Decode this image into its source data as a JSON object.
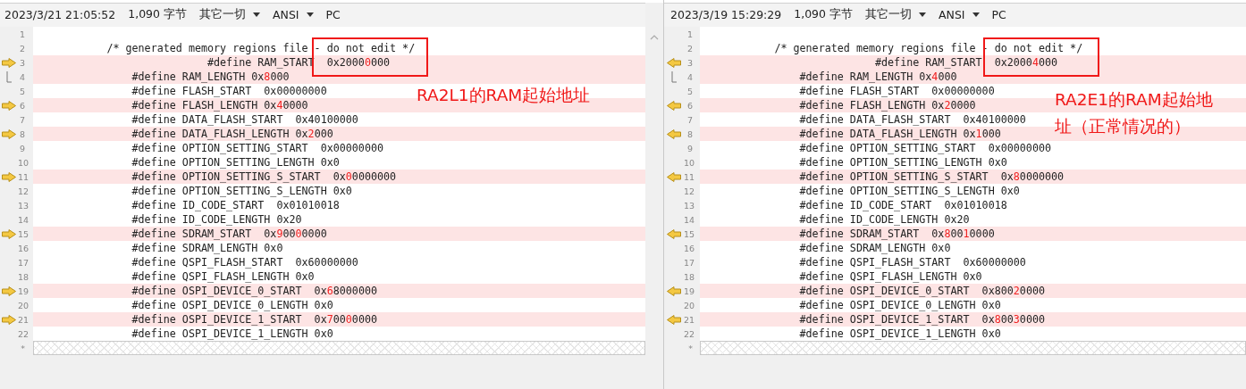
{
  "panes": [
    {
      "kind": "left",
      "header": {
        "timestamp": "2023/3/21 21:05:52",
        "size": "1,090 字节",
        "filter": "其它一切",
        "encoding": "ANSI",
        "line_ending": "PC"
      },
      "lines": [
        {
          "number": "1",
          "changed": false,
          "kind": "plain"
        },
        {
          "number": "2",
          "changed": false,
          "kind": "plain",
          "text": "           /* generated memory regions file - do not edit */"
        },
        {
          "number": "3",
          "changed": true,
          "kind": "arrow",
          "segments": [
            {
              "text": "                           #define RAM_START  0x2000",
              "diff": false
            },
            {
              "text": "0",
              "diff": true
            },
            {
              "text": "000",
              "diff": false
            }
          ]
        },
        {
          "number": "4",
          "changed": true,
          "kind": "bracket",
          "segments": [
            {
              "text": "               #define RAM_LENGTH 0x",
              "diff": false
            },
            {
              "text": "8",
              "diff": true
            },
            {
              "text": "000",
              "diff": false
            }
          ]
        },
        {
          "number": "5",
          "changed": false,
          "kind": "plain",
          "text": "               #define FLASH_START  0x00000000"
        },
        {
          "number": "6",
          "changed": true,
          "kind": "arrow",
          "segments": [
            {
              "text": "               #define FLASH_LENGTH 0x",
              "diff": false
            },
            {
              "text": "4",
              "diff": true
            },
            {
              "text": "0000",
              "diff": false
            }
          ]
        },
        {
          "number": "7",
          "changed": false,
          "kind": "plain",
          "text": "               #define DATA_FLASH_START  0x40100000"
        },
        {
          "number": "8",
          "changed": true,
          "kind": "arrow",
          "segments": [
            {
              "text": "               #define DATA_FLASH_LENGTH 0x",
              "diff": false
            },
            {
              "text": "2",
              "diff": true
            },
            {
              "text": "000",
              "diff": false
            }
          ]
        },
        {
          "number": "9",
          "changed": false,
          "kind": "plain",
          "text": "               #define OPTION_SETTING_START  0x00000000"
        },
        {
          "number": "10",
          "changed": false,
          "kind": "plain",
          "text": "               #define OPTION_SETTING_LENGTH 0x0"
        },
        {
          "number": "11",
          "changed": true,
          "kind": "arrow",
          "segments": [
            {
              "text": "               #define OPTION_SETTING_S_START  0x",
              "diff": false
            },
            {
              "text": "0",
              "diff": true
            },
            {
              "text": "0000000",
              "diff": false
            }
          ]
        },
        {
          "number": "12",
          "changed": false,
          "kind": "plain",
          "text": "               #define OPTION_SETTING_S_LENGTH 0x0"
        },
        {
          "number": "13",
          "changed": false,
          "kind": "plain",
          "text": "               #define ID_CODE_START  0x01010018"
        },
        {
          "number": "14",
          "changed": false,
          "kind": "plain",
          "text": "               #define ID_CODE_LENGTH 0x20"
        },
        {
          "number": "15",
          "changed": true,
          "kind": "arrow",
          "segments": [
            {
              "text": "               #define SDRAM_START  0x",
              "diff": false
            },
            {
              "text": "9",
              "diff": true
            },
            {
              "text": "00",
              "diff": false
            },
            {
              "text": "0",
              "diff": true
            },
            {
              "text": "0000",
              "diff": false
            }
          ]
        },
        {
          "number": "16",
          "changed": false,
          "kind": "plain",
          "text": "               #define SDRAM_LENGTH 0x0"
        },
        {
          "number": "17",
          "changed": false,
          "kind": "plain",
          "text": "               #define QSPI_FLASH_START  0x60000000"
        },
        {
          "number": "18",
          "changed": false,
          "kind": "plain",
          "text": "               #define QSPI_FLASH_LENGTH 0x0"
        },
        {
          "number": "19",
          "changed": true,
          "kind": "arrow",
          "segments": [
            {
              "text": "               #define OSPI_DEVICE_0_START  0x",
              "diff": false
            },
            {
              "text": "6",
              "diff": true
            },
            {
              "text": "8000000",
              "diff": false
            }
          ]
        },
        {
          "number": "20",
          "changed": false,
          "kind": "plain",
          "text": "               #define OSPI_DEVICE_0_LENGTH 0x0"
        },
        {
          "number": "21",
          "changed": true,
          "kind": "arrow",
          "segments": [
            {
              "text": "               #define OSPI_DEVICE_1_START  0x",
              "diff": false
            },
            {
              "text": "7",
              "diff": true
            },
            {
              "text": "00",
              "diff": false
            },
            {
              "text": "0",
              "diff": true
            },
            {
              "text": "0000",
              "diff": false
            }
          ]
        },
        {
          "number": "22",
          "changed": false,
          "kind": "plain",
          "text": "               #define OSPI_DEVICE_1_LENGTH 0x0"
        }
      ],
      "end_marker": "*",
      "annotation": "RA2L1的RAM起始地址"
    },
    {
      "kind": "right",
      "header": {
        "timestamp": "2023/3/19 15:29:29",
        "size": "1,090 字节",
        "filter": "其它一切",
        "encoding": "ANSI",
        "line_ending": "PC"
      },
      "lines": [
        {
          "number": "1",
          "changed": false,
          "kind": "plain"
        },
        {
          "number": "2",
          "changed": false,
          "kind": "plain",
          "text": "           /* generated memory regions file - do not edit */"
        },
        {
          "number": "3",
          "changed": true,
          "kind": "arrow",
          "segments": [
            {
              "text": "                           #define RAM_START  0x2000",
              "diff": false
            },
            {
              "text": "4",
              "diff": true
            },
            {
              "text": "000",
              "diff": false
            }
          ]
        },
        {
          "number": "4",
          "changed": true,
          "kind": "bracket",
          "segments": [
            {
              "text": "               #define RAM_LENGTH 0x",
              "diff": false
            },
            {
              "text": "4",
              "diff": true
            },
            {
              "text": "000",
              "diff": false
            }
          ]
        },
        {
          "number": "5",
          "changed": false,
          "kind": "plain",
          "text": "               #define FLASH_START  0x00000000"
        },
        {
          "number": "6",
          "changed": true,
          "kind": "arrow",
          "segments": [
            {
              "text": "               #define FLASH_LENGTH 0x",
              "diff": false
            },
            {
              "text": "2",
              "diff": true
            },
            {
              "text": "0000",
              "diff": false
            }
          ]
        },
        {
          "number": "7",
          "changed": false,
          "kind": "plain",
          "text": "               #define DATA_FLASH_START  0x40100000"
        },
        {
          "number": "8",
          "changed": true,
          "kind": "arrow",
          "segments": [
            {
              "text": "               #define DATA_FLASH_LENGTH 0x",
              "diff": false
            },
            {
              "text": "1",
              "diff": true
            },
            {
              "text": "000",
              "diff": false
            }
          ]
        },
        {
          "number": "9",
          "changed": false,
          "kind": "plain",
          "text": "               #define OPTION_SETTING_START  0x00000000"
        },
        {
          "number": "10",
          "changed": false,
          "kind": "plain",
          "text": "               #define OPTION_SETTING_LENGTH 0x0"
        },
        {
          "number": "11",
          "changed": true,
          "kind": "arrow",
          "segments": [
            {
              "text": "               #define OPTION_SETTING_S_START  0x",
              "diff": false
            },
            {
              "text": "8",
              "diff": true
            },
            {
              "text": "0000000",
              "diff": false
            }
          ]
        },
        {
          "number": "12",
          "changed": false,
          "kind": "plain",
          "text": "               #define OPTION_SETTING_S_LENGTH 0x0"
        },
        {
          "number": "13",
          "changed": false,
          "kind": "plain",
          "text": "               #define ID_CODE_START  0x01010018"
        },
        {
          "number": "14",
          "changed": false,
          "kind": "plain",
          "text": "               #define ID_CODE_LENGTH 0x20"
        },
        {
          "number": "15",
          "changed": true,
          "kind": "arrow",
          "segments": [
            {
              "text": "               #define SDRAM_START  0x",
              "diff": false
            },
            {
              "text": "8",
              "diff": true
            },
            {
              "text": "00",
              "diff": false
            },
            {
              "text": "1",
              "diff": true
            },
            {
              "text": "0000",
              "diff": false
            }
          ]
        },
        {
          "number": "16",
          "changed": false,
          "kind": "plain",
          "text": "               #define SDRAM_LENGTH 0x0"
        },
        {
          "number": "17",
          "changed": false,
          "kind": "plain",
          "text": "               #define QSPI_FLASH_START  0x60000000"
        },
        {
          "number": "18",
          "changed": false,
          "kind": "plain",
          "text": "               #define QSPI_FLASH_LENGTH 0x0"
        },
        {
          "number": "19",
          "changed": true,
          "kind": "arrow",
          "segments": [
            {
              "text": "               #define OSPI_DEVICE_0_START  0x800",
              "diff": false
            },
            {
              "text": "2",
              "diff": true
            },
            {
              "text": "0000",
              "diff": false
            }
          ]
        },
        {
          "number": "20",
          "changed": false,
          "kind": "plain",
          "text": "               #define OSPI_DEVICE_0_LENGTH 0x0"
        },
        {
          "number": "21",
          "changed": true,
          "kind": "arrow",
          "segments": [
            {
              "text": "               #define OSPI_DEVICE_1_START  0x",
              "diff": false
            },
            {
              "text": "8",
              "diff": true
            },
            {
              "text": "00",
              "diff": false
            },
            {
              "text": "3",
              "diff": true
            },
            {
              "text": "0000",
              "diff": false
            }
          ]
        },
        {
          "number": "22",
          "changed": false,
          "kind": "plain",
          "text": "               #define OSPI_DEVICE_1_LENGTH 0x0"
        }
      ],
      "end_marker": "*",
      "annotation": "RA2E1的RAM起始地址（正常情况的）"
    }
  ]
}
